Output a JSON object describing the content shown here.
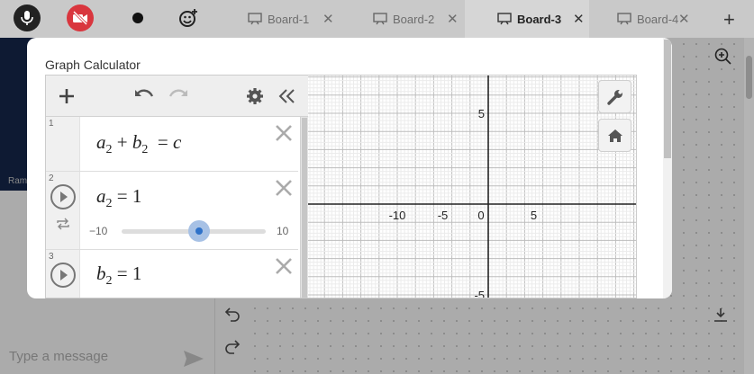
{
  "tabs": [
    {
      "label": "Board-1",
      "active": false
    },
    {
      "label": "Board-2",
      "active": false
    },
    {
      "label": "Board-3",
      "active": true
    },
    {
      "label": "Board-4",
      "active": false
    }
  ],
  "video": {
    "name_partial": "Ram"
  },
  "chat": {
    "placeholder": "Type a message"
  },
  "modal": {
    "title": "Graph Calculator"
  },
  "expressions": [
    {
      "number": "1",
      "latex": "a_2 + b_2 = c"
    },
    {
      "number": "2",
      "latex": "a_2 = 1",
      "slider": {
        "min": "−10",
        "max": "10",
        "value": 1
      }
    },
    {
      "number": "3",
      "latex": "b_2 = 1"
    }
  ],
  "graph": {
    "x_ticks": [
      "-10",
      "-5",
      "0",
      "5"
    ],
    "y_ticks": [
      "5",
      "-5"
    ]
  },
  "colors": {
    "slider_knob": "#2f72c9",
    "recording_off": "#d9363e"
  },
  "icons": [
    "mic-icon",
    "video-off-icon",
    "record-icon",
    "emoji-icon",
    "board-icon",
    "close-icon",
    "add-board-icon",
    "zoom-in-icon",
    "undo-icon",
    "redo-icon",
    "download-icon",
    "send-icon",
    "plus-icon",
    "gear-icon",
    "collapse-icon",
    "wrench-icon",
    "home-icon",
    "play-icon",
    "loop-icon"
  ]
}
